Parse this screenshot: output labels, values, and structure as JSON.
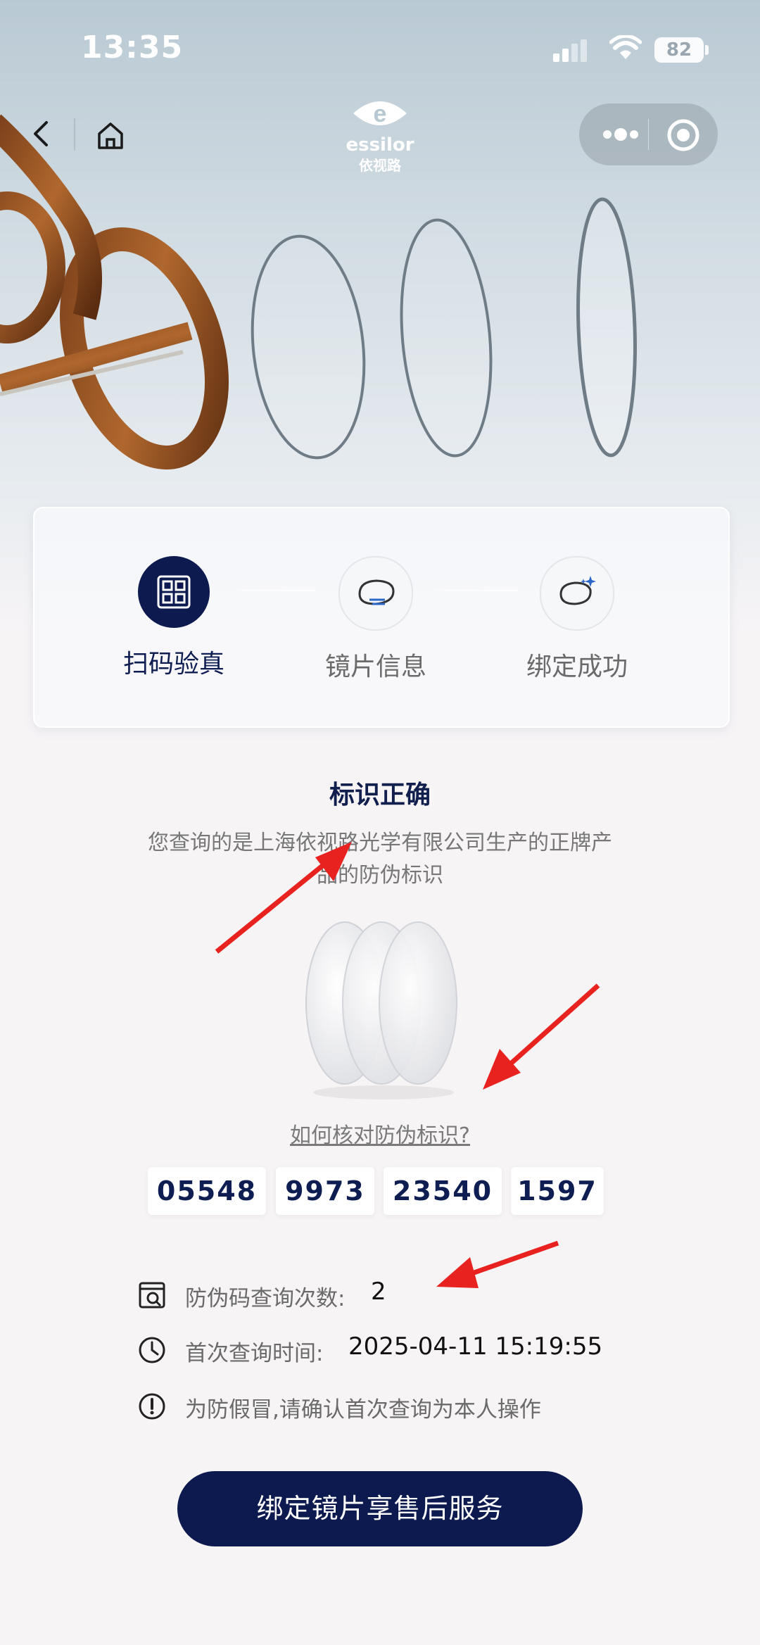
{
  "status_bar": {
    "time": "13:35",
    "battery": "82",
    "icons": [
      "cellular-signal-icon",
      "wifi-icon",
      "battery-icon"
    ]
  },
  "nav": {
    "back_icon": "chevron-left-icon",
    "home_icon": "home-icon",
    "logo_en": "essilor",
    "logo_cn": "依视路",
    "menu_icon": "more-dots-icon",
    "close_icon": "target-circle-icon"
  },
  "steps": [
    {
      "label": "扫码验真",
      "icon": "qr-scan-icon",
      "active": true
    },
    {
      "label": "镜片信息",
      "icon": "lens-info-icon",
      "active": false
    },
    {
      "label": "绑定成功",
      "icon": "lens-sparkle-icon",
      "active": false
    }
  ],
  "result": {
    "title": "标识正确",
    "description": "您查询的是上海依视路光学有限公司生产的正牌产品的防伪标识",
    "help_link": "如何核对防伪标识?"
  },
  "codes": [
    "05548",
    "9973",
    "23540",
    "1597"
  ],
  "info": {
    "query_count_label": "防伪码查询次数:",
    "query_count_value": "2",
    "first_query_label": "首次查询时间:",
    "first_query_value": "2025-04-11  15:19:55",
    "warning": "为防假冒,请确认首次查询为本人操作"
  },
  "cta": {
    "label": "绑定镜片享售后服务"
  },
  "colors": {
    "brand_navy": "#0d1a4f",
    "annotation_arrow": "#e8221e"
  }
}
